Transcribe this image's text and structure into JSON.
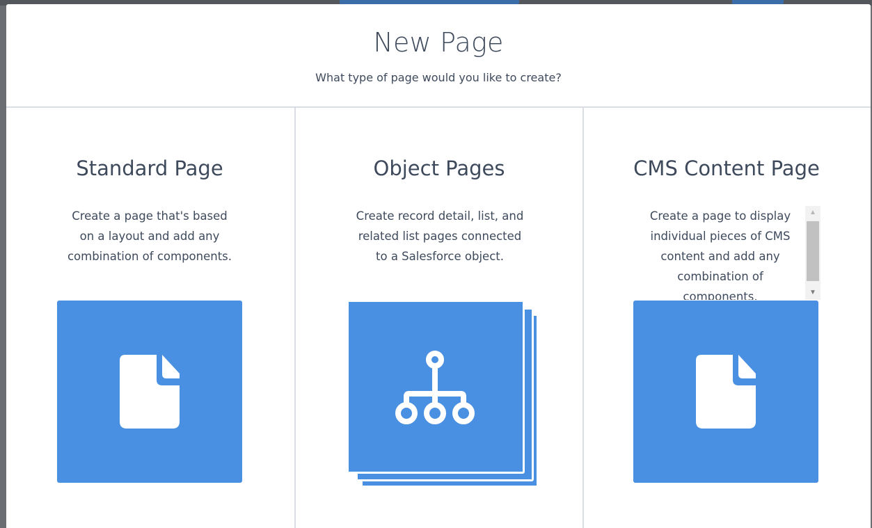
{
  "modal": {
    "title": "New Page",
    "subtitle": "What type of page would you like to create?"
  },
  "options": [
    {
      "title": "Standard Page",
      "description": "Create a page that's based on a layout and add any combination of components.",
      "icon": "document-icon"
    },
    {
      "title": "Object Pages",
      "description": "Create record detail, list, and related list pages connected to a Salesforce object.",
      "icon": "hierarchy-icon"
    },
    {
      "title": "CMS Content Page",
      "description": "Create a page to display individual pieces of CMS content and add any combination of components.",
      "icon": "document-icon"
    }
  ],
  "colors": {
    "tile": "#4a90e2",
    "text": "#3e4a5c",
    "divider": "#d8dde6"
  }
}
